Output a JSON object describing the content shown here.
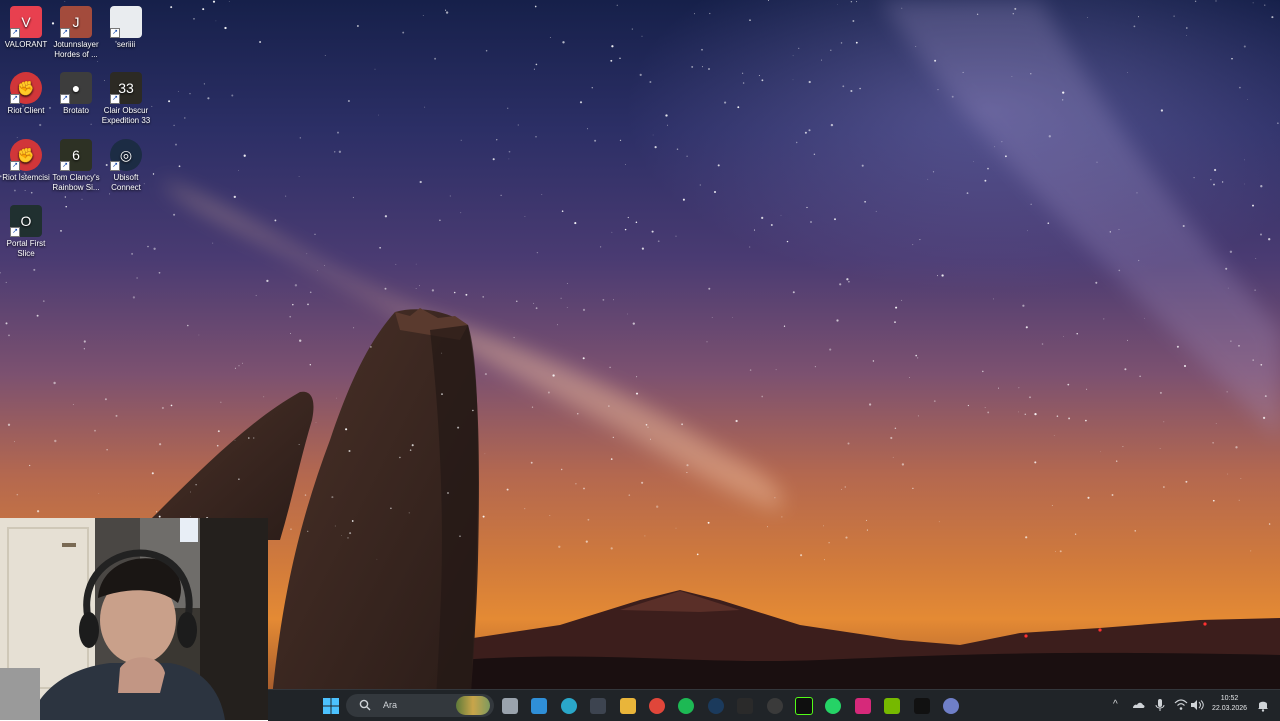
{
  "desktop": {
    "icons": [
      {
        "label": "VALORANT",
        "icon": "valorant-icon",
        "color": "#e8404f"
      },
      {
        "label": "Jotunnslayer Hordes of ...",
        "icon": "jotunnslayer-icon",
        "color": "#a34b3c"
      },
      {
        "label": "seriiii",
        "icon": "text-file-icon",
        "color": "#e9ecef"
      },
      {
        "label": "Riot Client",
        "icon": "riot-client-icon",
        "color": "#d13639"
      },
      {
        "label": "Brotato",
        "icon": "brotato-icon",
        "color": "#3d3d3d"
      },
      {
        "label": "Clair Obscur Expedition 33",
        "icon": "clair-obscur-icon",
        "color": "#2c2a24"
      },
      {
        "label": "Riot İstemcisi",
        "icon": "riot-client-icon",
        "color": "#d13639"
      },
      {
        "label": "Tom Clancy's Rainbow Si...",
        "icon": "rainbow-six-icon",
        "color": "#2d3124"
      },
      {
        "label": "Ubisoft Connect",
        "icon": "ubisoft-icon",
        "color": "#1c2c44"
      },
      {
        "label": "Portal First Slice",
        "icon": "portal-icon",
        "color": "#203030"
      }
    ]
  },
  "taskbar": {
    "search_placeholder": "Ara",
    "apps": [
      {
        "name": "task-view",
        "icon": "task-view-icon"
      },
      {
        "name": "widgets",
        "icon": "widgets-icon"
      },
      {
        "name": "edge",
        "icon": "edge-icon"
      },
      {
        "name": "store",
        "icon": "store-icon"
      },
      {
        "name": "file-explorer",
        "icon": "folder-icon"
      },
      {
        "name": "chrome",
        "icon": "chrome-icon"
      },
      {
        "name": "spotify",
        "icon": "spotify-icon"
      },
      {
        "name": "steam",
        "icon": "steam-icon"
      },
      {
        "name": "epic-games",
        "icon": "epic-games-icon"
      },
      {
        "name": "riot",
        "icon": "riot-icon"
      },
      {
        "name": "kick",
        "icon": "kick-icon"
      },
      {
        "name": "whatsapp",
        "icon": "whatsapp-icon"
      },
      {
        "name": "instagram",
        "icon": "instagram-icon"
      },
      {
        "name": "nvidia",
        "icon": "nvidia-icon"
      },
      {
        "name": "g-app",
        "icon": "g-icon"
      },
      {
        "name": "app-circle",
        "icon": "circle-app-icon"
      }
    ],
    "tray": {
      "chevron": "^",
      "time": "10:52",
      "date": "22.03.2026"
    }
  }
}
